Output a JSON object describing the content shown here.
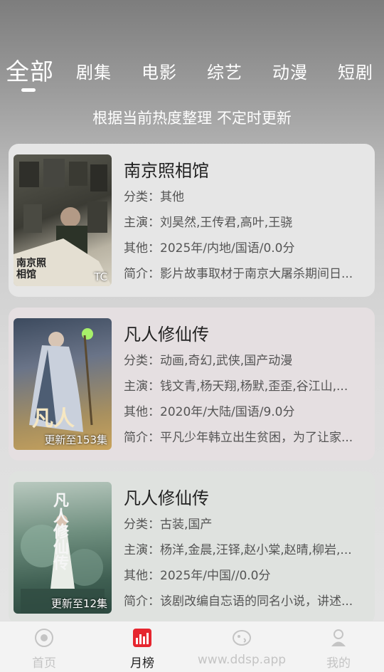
{
  "tabs": [
    {
      "label": "全部",
      "active": true
    },
    {
      "label": "剧集",
      "active": false
    },
    {
      "label": "电影",
      "active": false
    },
    {
      "label": "综艺",
      "active": false
    },
    {
      "label": "动漫",
      "active": false
    },
    {
      "label": "短剧",
      "active": false
    }
  ],
  "subtitle": "根据当前热度整理 不定时更新",
  "items": [
    {
      "title": "南京照相馆",
      "category": "分类：其他",
      "cast": "主演：刘昊然,王传君,高叶,王骁",
      "other": "其他：2025年/内地/国语/0.0分",
      "intro": "简介：影片故事取材于南京大屠杀期间日...",
      "badge": "TC",
      "poster_text": "南京照相馆"
    },
    {
      "title": "凡人修仙传",
      "category": "分类：动画,奇幻,武侠,国产动漫",
      "cast": "主演：钱文青,杨天翔,杨默,歪歪,谷江山,...",
      "other": "其他：2020年/大陆/国语/9.0分",
      "intro": "简介：平凡少年韩立出生贫困，为了让家...",
      "badge": "更新至153集",
      "poster_text": "凡人"
    },
    {
      "title": "凡人修仙传",
      "category": "分类：古装,国产",
      "cast": "主演：杨洋,金晨,汪铎,赵小棠,赵晴,柳岩,...",
      "other": "其他：2025年/中国//0.0分",
      "intro": "简介：该剧改编自忘语的同名小说，讲述...",
      "badge": "更新至12集",
      "poster_text": "凡人修仙传"
    }
  ],
  "nav": [
    {
      "label": "首页",
      "icon": "home-icon",
      "active": false
    },
    {
      "label": "月榜",
      "icon": "chart-icon",
      "active": true
    },
    {
      "label": "www.ddsp.app",
      "icon": "fish-icon",
      "active": false
    },
    {
      "label": "我的",
      "icon": "user-icon",
      "active": false
    }
  ],
  "colors": {
    "accent": "#e6262f",
    "inactive": "#c4c4c4"
  }
}
